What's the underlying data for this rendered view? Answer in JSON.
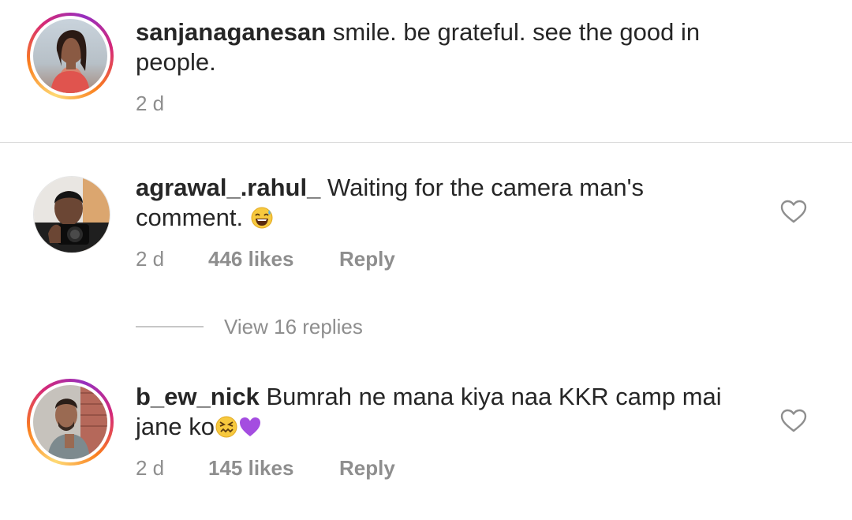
{
  "comments": [
    {
      "username": "sanjanaganesan",
      "text_line1": "smile. be grateful. see the good in",
      "text_line2": "people.",
      "time": "2 d",
      "avatar_icon": "woman-portrait-avatar"
    },
    {
      "username": "agrawal_.rahul_",
      "text_line1": "Waiting for the camera man's",
      "text_line2": "comment.",
      "emoji": "grinning-sweat-emoji",
      "time": "2 d",
      "likes": "446 likes",
      "reply": "Reply",
      "avatar_icon": "man-with-camera-avatar",
      "liked": false
    },
    {
      "username": "b_ew_nick",
      "text_line1": "Bumrah ne mana kiya naa KKR camp mai",
      "text_line2": "jane ko",
      "emoji": [
        "confounded-face-emoji",
        "purple-heart-emoji"
      ],
      "time": "2 d",
      "likes": "145 likes",
      "reply": "Reply",
      "avatar_icon": "man-portrait-avatar",
      "liked": false
    }
  ],
  "view_replies": "View 16 replies",
  "colors": {
    "text": "#262626",
    "secondary": "#8e8e8e",
    "divider": "#dbdbdb",
    "heart_outline": "#8e8e8e"
  }
}
